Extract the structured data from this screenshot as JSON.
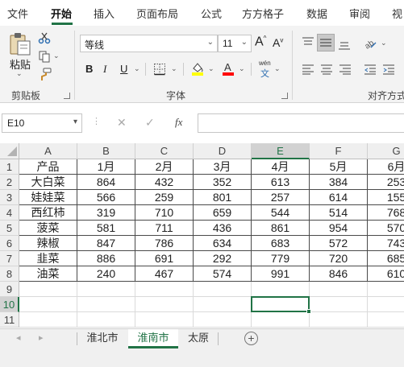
{
  "menu": {
    "tabs": [
      "文件",
      "开始",
      "插入",
      "页面布局",
      "公式",
      "方方格子",
      "数据",
      "审阅",
      "视"
    ]
  },
  "ribbon": {
    "clipboard": {
      "paste_label": "粘贴",
      "group_label": "剪贴板"
    },
    "font": {
      "name": "等线",
      "size": "11",
      "grow": "A",
      "shrink": "A",
      "bold": "B",
      "italic": "I",
      "underline": "U",
      "group_label": "字体",
      "phonetic_top": "wén",
      "phonetic_bottom": "文"
    },
    "alignment": {
      "group_label": "对齐方式"
    },
    "colors": {
      "fill": "#FFFF00",
      "font": "#FF0000",
      "accent": "#217346"
    }
  },
  "formula_bar": {
    "name_box": "E10",
    "cancel": "✕",
    "confirm": "✓",
    "fx": "fx",
    "value": ""
  },
  "grid": {
    "columns": [
      "A",
      "B",
      "C",
      "D",
      "E",
      "F",
      "G"
    ],
    "rows": [
      "1",
      "2",
      "3",
      "4",
      "5",
      "6",
      "7",
      "8",
      "9",
      "10",
      "11"
    ],
    "selected_cell": "E10",
    "cells": [
      [
        "产品",
        "1月",
        "2月",
        "3月",
        "4月",
        "5月",
        "6月"
      ],
      [
        "大白菜",
        "864",
        "432",
        "352",
        "613",
        "384",
        "253"
      ],
      [
        "娃娃菜",
        "566",
        "259",
        "801",
        "257",
        "614",
        "155"
      ],
      [
        "西红柿",
        "319",
        "710",
        "659",
        "544",
        "514",
        "768"
      ],
      [
        "菠菜",
        "581",
        "711",
        "436",
        "861",
        "954",
        "570"
      ],
      [
        "辣椒",
        "847",
        "786",
        "634",
        "683",
        "572",
        "743"
      ],
      [
        "韭菜",
        "886",
        "691",
        "292",
        "779",
        "720",
        "685"
      ],
      [
        "油菜",
        "240",
        "467",
        "574",
        "991",
        "846",
        "610"
      ]
    ]
  },
  "sheets": {
    "tabs": [
      "淮北市",
      "淮南市",
      "太原"
    ],
    "active": "淮南市",
    "add": "+"
  }
}
